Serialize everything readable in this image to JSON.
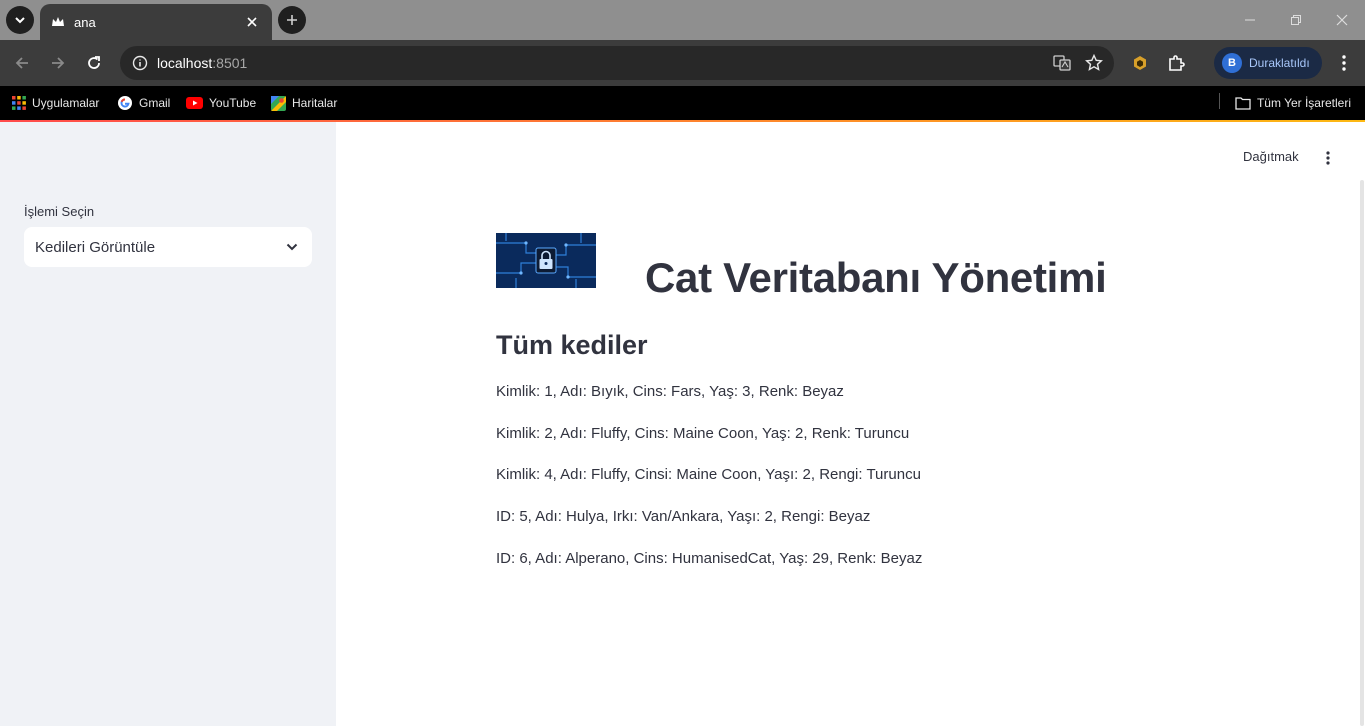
{
  "browser": {
    "tab": {
      "title": "ana"
    },
    "address_bar": {
      "host": "localhost",
      "port": ":8501"
    },
    "profile": {
      "initial": "B",
      "status": "Duraklatıldı"
    },
    "bookmarks": [
      {
        "label": "Uygulamalar",
        "icon": "apps-grid-icon"
      },
      {
        "label": "Gmail",
        "icon": "google-icon"
      },
      {
        "label": "YouTube",
        "icon": "youtube-icon"
      },
      {
        "label": "Haritalar",
        "icon": "maps-icon"
      }
    ],
    "all_bookmarks_label": "Tüm Yer İşaretleri"
  },
  "sidebar": {
    "select_label": "İşlemi Seçin",
    "select_value": "Kedileri Görüntüle"
  },
  "header": {
    "deploy_label": "Dağıtmak"
  },
  "main": {
    "title": "Cat Veritabanı Yönetimi",
    "section_title": "Tüm kediler",
    "cats": [
      "Kimlik: 1, Adı: Bıyık, Cins: Fars, Yaş: 3, Renk: Beyaz",
      "Kimlik: 2, Adı: Fluffy, Cins: Maine Coon, Yaş: 2, Renk: Turuncu",
      "Kimlik: 4, Adı: Fluffy, Cinsi: Maine Coon, Yaşı: 2, Rengi: Turuncu",
      "ID: 5, Adı: Hulya, Irkı: Van/Ankara, Yaşı: 2, Rengi: Beyaz",
      "ID: 6, Adı: Alperano, Cins: HumanisedCat, Yaş: 29, Renk: Beyaz"
    ]
  },
  "colors": {
    "tab_strip": "#8f8f8f",
    "toolbar": "#3c3c3c",
    "bookmarks_bar": "#000000",
    "sidebar_bg": "#f0f2f6",
    "text": "#31333f"
  }
}
